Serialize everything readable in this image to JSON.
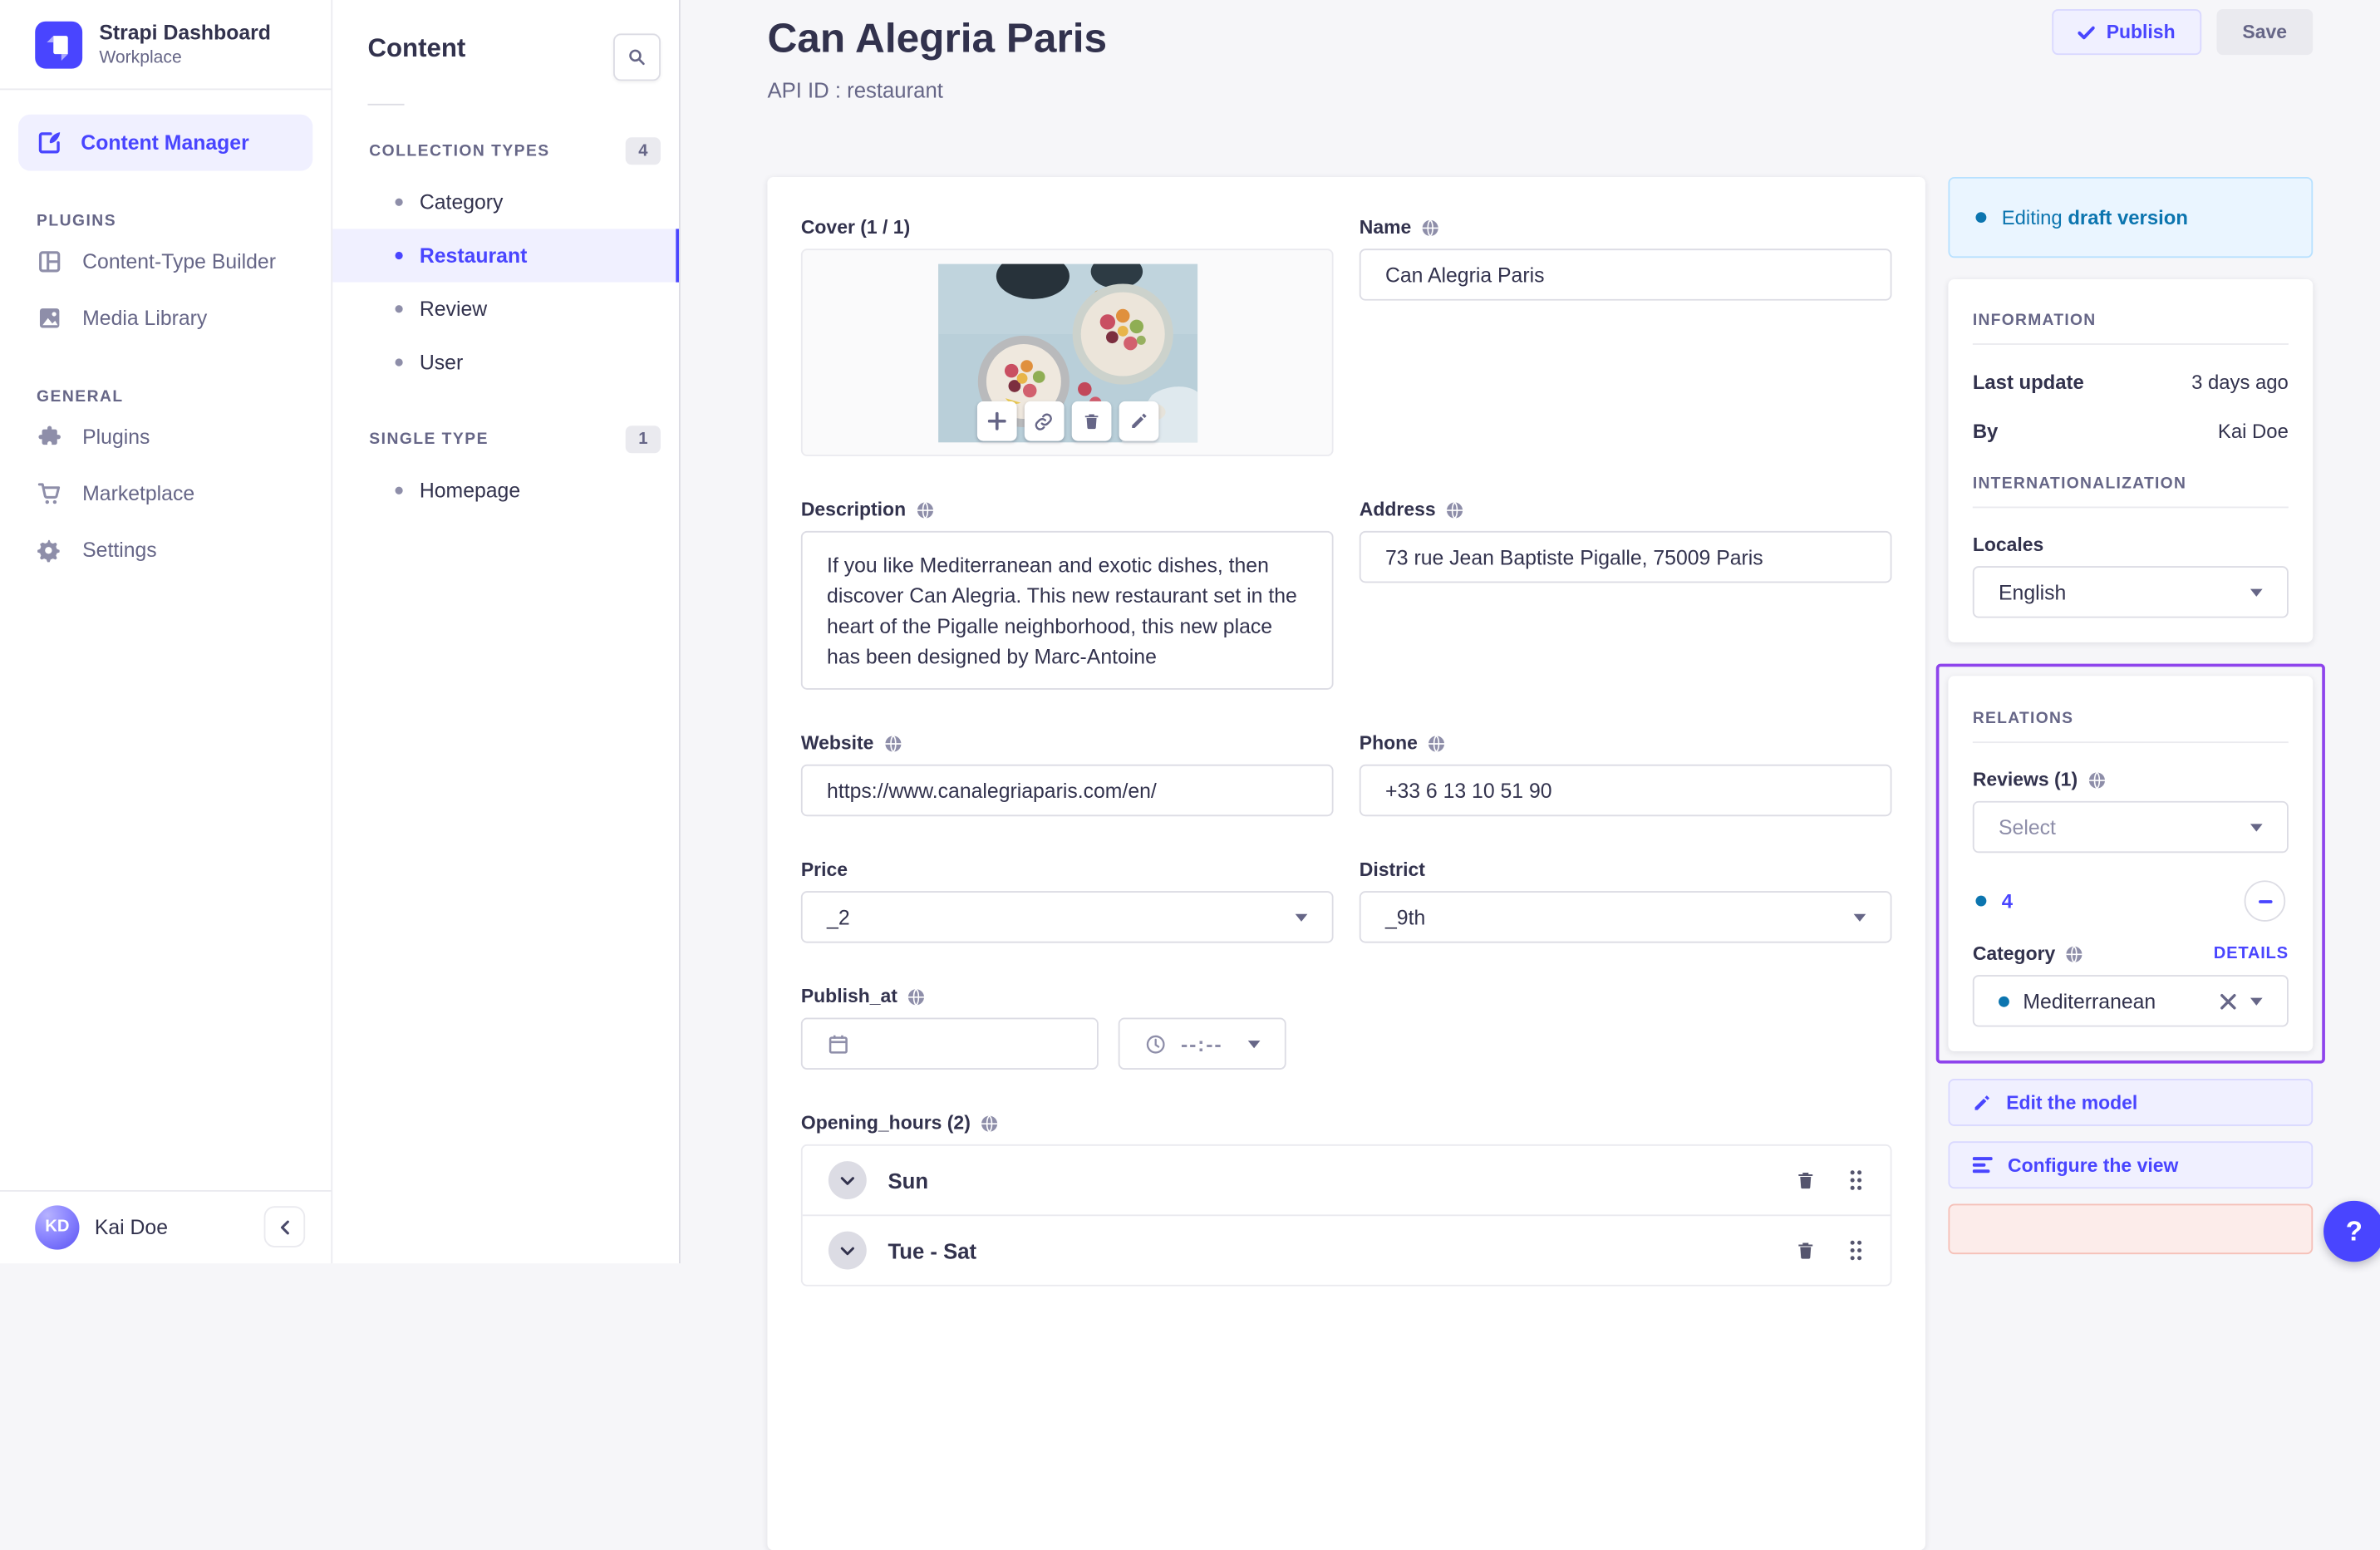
{
  "colors": {
    "accent": "#4945ff",
    "accent_bg": "#f0f0ff",
    "accent_border": "#d9d8ff",
    "draft_text": "#0c75af",
    "draft_bg": "#eaf5ff",
    "highlight_purple": "#8e44ec",
    "danger_bg": "#fcecea"
  },
  "app": {
    "title": "Strapi Dashboard",
    "workspace": "Workplace"
  },
  "nav": {
    "primary_item": "Content Manager",
    "sections": [
      {
        "label": "PLUGINS",
        "items": [
          {
            "label": "Content-Type Builder"
          },
          {
            "label": "Media Library"
          }
        ]
      },
      {
        "label": "GENERAL",
        "items": [
          {
            "label": "Plugins"
          },
          {
            "label": "Marketplace"
          },
          {
            "label": "Settings"
          }
        ]
      }
    ],
    "user": {
      "initials": "KD",
      "name": "Kai Doe"
    }
  },
  "subnav": {
    "title": "Content",
    "groups": [
      {
        "label": "COLLECTION TYPES",
        "count": "4",
        "items": [
          {
            "label": "Category"
          },
          {
            "label": "Restaurant"
          },
          {
            "label": "Review"
          },
          {
            "label": "User"
          }
        ]
      },
      {
        "label": "SINGLE TYPE",
        "count": "1",
        "items": [
          {
            "label": "Homepage"
          }
        ]
      }
    ]
  },
  "header": {
    "title": "Can Alegria Paris",
    "subtitle": "API ID : restaurant",
    "publish": "Publish",
    "save": "Save"
  },
  "form": {
    "cover": {
      "label": "Cover (1 / 1)"
    },
    "name": {
      "label": "Name",
      "value": "Can Alegria Paris"
    },
    "description": {
      "label": "Description",
      "value": "If you like Mediterranean and exotic dishes, then discover Can Alegria. This new restaurant set in the heart of the Pigalle neighborhood, this new place has been designed by Marc-Antoine"
    },
    "address": {
      "label": "Address",
      "value": "73 rue Jean Baptiste Pigalle, 75009 Paris"
    },
    "website": {
      "label": "Website",
      "value": "https://www.canalegriaparis.com/en/"
    },
    "phone": {
      "label": "Phone",
      "value": "+33 6 13 10 51 90"
    },
    "price": {
      "label": "Price",
      "value": "_2"
    },
    "district": {
      "label": "District",
      "value": "_9th"
    },
    "publish_at": {
      "label": "Publish_at",
      "time_placeholder": "--:--"
    },
    "opening_hours": {
      "label": "Opening_hours (2)",
      "entries": [
        {
          "label": "Sun"
        },
        {
          "label": "Tue - Sat"
        }
      ]
    }
  },
  "panel": {
    "status": {
      "prefix": "Editing ",
      "emphasis": "draft version"
    },
    "information": {
      "title": "INFORMATION",
      "rows": [
        {
          "label": "Last update",
          "value": "3 days ago"
        },
        {
          "label": "By",
          "value": "Kai Doe"
        }
      ]
    },
    "internationalization": {
      "title": "INTERNATIONALIZATION",
      "locales_label": "Locales",
      "locale": "English"
    },
    "relations": {
      "title": "RELATIONS",
      "reviews_label": "Reviews (1)",
      "reviews_placeholder": "Select",
      "linked_review": "4",
      "category_label": "Category",
      "details": "DETAILS",
      "category_value": "Mediterranean"
    },
    "actions": {
      "edit_model": "Edit the model",
      "configure_view": "Configure the view"
    },
    "help": "?"
  }
}
